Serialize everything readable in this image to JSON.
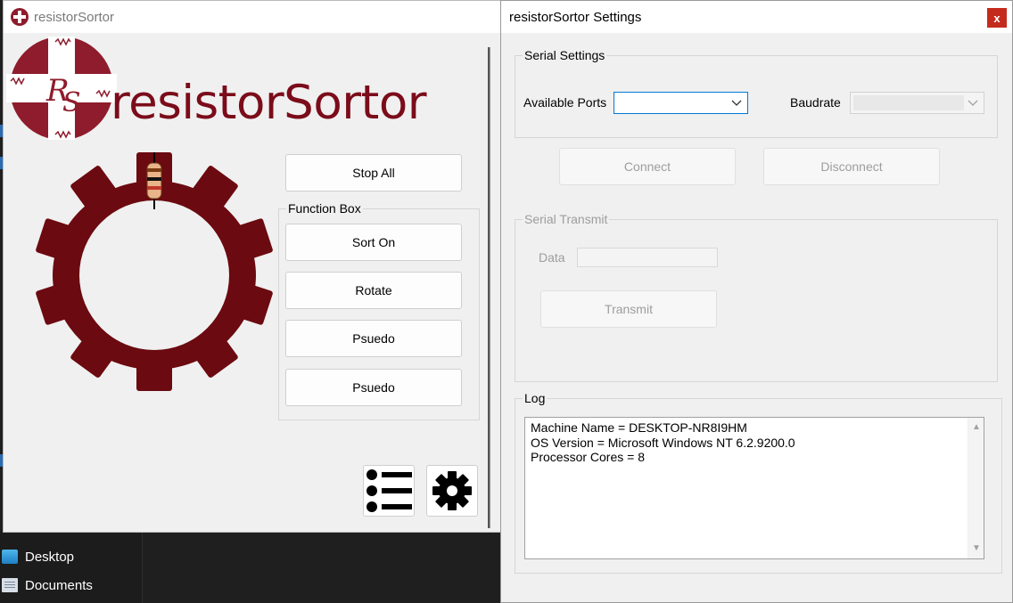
{
  "main_window": {
    "title": "resistorSortor",
    "brand_text": "resistorSortor",
    "stop_all_label": "Stop All",
    "function_box": {
      "title": "Function Box",
      "buttons": [
        "Sort On",
        "Rotate",
        "Psuedo",
        "Psuedo"
      ]
    },
    "icons": [
      "list-icon",
      "gear-icon"
    ]
  },
  "settings_window": {
    "title": "resistorSortor Settings",
    "close_label": "x",
    "serial_settings": {
      "title": "Serial Settings",
      "ports_label": "Available Ports",
      "ports_value": "",
      "baudrate_label": "Baudrate",
      "baudrate_value": ""
    },
    "connect_label": "Connect",
    "disconnect_label": "Disconnect",
    "serial_transmit": {
      "title": "Serial Transmit",
      "data_label": "Data",
      "data_value": "",
      "transmit_label": "Transmit"
    },
    "log": {
      "title": "Log",
      "lines": [
        "Machine Name = DESKTOP-NR8I9HM",
        "OS Version = Microsoft Windows NT 6.2.9200.0",
        "Processor Cores = 8"
      ]
    }
  },
  "explorer": {
    "items": [
      "Desktop",
      "Documents"
    ]
  },
  "colors": {
    "brand": "#7b0c1a",
    "gear": "#6b0a10",
    "close": "#c42b1c",
    "focus": "#0078d7"
  }
}
